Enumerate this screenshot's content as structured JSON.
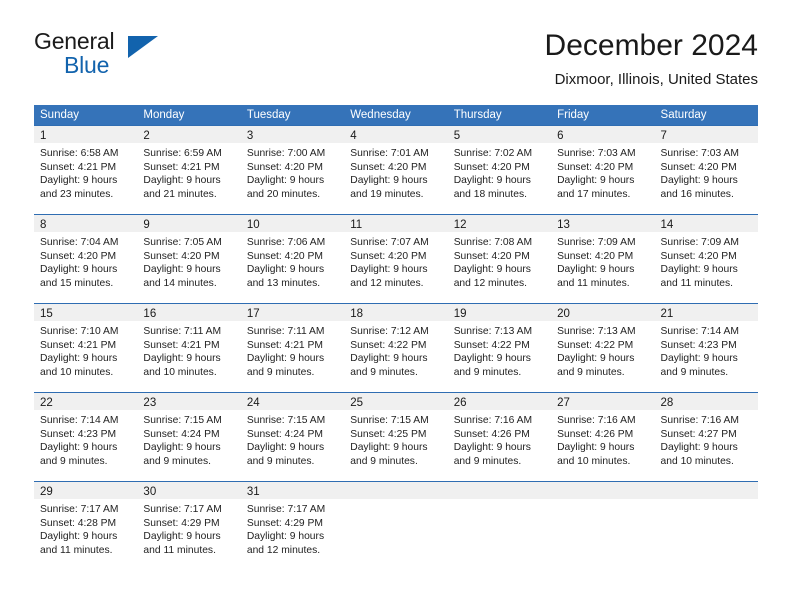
{
  "brand": {
    "name_line1": "General",
    "name_line2": "Blue",
    "triangle_color": "#1263ad",
    "triangle_icon": "triangle-logo-icon"
  },
  "header": {
    "title": "December 2024",
    "subtitle": "Dixmoor, Illinois, United States"
  },
  "colors": {
    "header_row_bg": "#3573b9",
    "row_top_border": "#2f6db2",
    "day_band_bg": "#f0f0f0",
    "brand_blue": "#1263ad",
    "text": "#1a1a1a"
  },
  "weekday_headers": [
    "Sunday",
    "Monday",
    "Tuesday",
    "Wednesday",
    "Thursday",
    "Friday",
    "Saturday"
  ],
  "weeks": [
    [
      {
        "day": "1",
        "sunrise": "Sunrise: 6:58 AM",
        "sunset": "Sunset: 4:21 PM",
        "daylight_1": "Daylight: 9 hours",
        "daylight_2": "and 23 minutes."
      },
      {
        "day": "2",
        "sunrise": "Sunrise: 6:59 AM",
        "sunset": "Sunset: 4:21 PM",
        "daylight_1": "Daylight: 9 hours",
        "daylight_2": "and 21 minutes."
      },
      {
        "day": "3",
        "sunrise": "Sunrise: 7:00 AM",
        "sunset": "Sunset: 4:20 PM",
        "daylight_1": "Daylight: 9 hours",
        "daylight_2": "and 20 minutes."
      },
      {
        "day": "4",
        "sunrise": "Sunrise: 7:01 AM",
        "sunset": "Sunset: 4:20 PM",
        "daylight_1": "Daylight: 9 hours",
        "daylight_2": "and 19 minutes."
      },
      {
        "day": "5",
        "sunrise": "Sunrise: 7:02 AM",
        "sunset": "Sunset: 4:20 PM",
        "daylight_1": "Daylight: 9 hours",
        "daylight_2": "and 18 minutes."
      },
      {
        "day": "6",
        "sunrise": "Sunrise: 7:03 AM",
        "sunset": "Sunset: 4:20 PM",
        "daylight_1": "Daylight: 9 hours",
        "daylight_2": "and 17 minutes."
      },
      {
        "day": "7",
        "sunrise": "Sunrise: 7:03 AM",
        "sunset": "Sunset: 4:20 PM",
        "daylight_1": "Daylight: 9 hours",
        "daylight_2": "and 16 minutes."
      }
    ],
    [
      {
        "day": "8",
        "sunrise": "Sunrise: 7:04 AM",
        "sunset": "Sunset: 4:20 PM",
        "daylight_1": "Daylight: 9 hours",
        "daylight_2": "and 15 minutes."
      },
      {
        "day": "9",
        "sunrise": "Sunrise: 7:05 AM",
        "sunset": "Sunset: 4:20 PM",
        "daylight_1": "Daylight: 9 hours",
        "daylight_2": "and 14 minutes."
      },
      {
        "day": "10",
        "sunrise": "Sunrise: 7:06 AM",
        "sunset": "Sunset: 4:20 PM",
        "daylight_1": "Daylight: 9 hours",
        "daylight_2": "and 13 minutes."
      },
      {
        "day": "11",
        "sunrise": "Sunrise: 7:07 AM",
        "sunset": "Sunset: 4:20 PM",
        "daylight_1": "Daylight: 9 hours",
        "daylight_2": "and 12 minutes."
      },
      {
        "day": "12",
        "sunrise": "Sunrise: 7:08 AM",
        "sunset": "Sunset: 4:20 PM",
        "daylight_1": "Daylight: 9 hours",
        "daylight_2": "and 12 minutes."
      },
      {
        "day": "13",
        "sunrise": "Sunrise: 7:09 AM",
        "sunset": "Sunset: 4:20 PM",
        "daylight_1": "Daylight: 9 hours",
        "daylight_2": "and 11 minutes."
      },
      {
        "day": "14",
        "sunrise": "Sunrise: 7:09 AM",
        "sunset": "Sunset: 4:20 PM",
        "daylight_1": "Daylight: 9 hours",
        "daylight_2": "and 11 minutes."
      }
    ],
    [
      {
        "day": "15",
        "sunrise": "Sunrise: 7:10 AM",
        "sunset": "Sunset: 4:21 PM",
        "daylight_1": "Daylight: 9 hours",
        "daylight_2": "and 10 minutes."
      },
      {
        "day": "16",
        "sunrise": "Sunrise: 7:11 AM",
        "sunset": "Sunset: 4:21 PM",
        "daylight_1": "Daylight: 9 hours",
        "daylight_2": "and 10 minutes."
      },
      {
        "day": "17",
        "sunrise": "Sunrise: 7:11 AM",
        "sunset": "Sunset: 4:21 PM",
        "daylight_1": "Daylight: 9 hours",
        "daylight_2": "and 9 minutes."
      },
      {
        "day": "18",
        "sunrise": "Sunrise: 7:12 AM",
        "sunset": "Sunset: 4:22 PM",
        "daylight_1": "Daylight: 9 hours",
        "daylight_2": "and 9 minutes."
      },
      {
        "day": "19",
        "sunrise": "Sunrise: 7:13 AM",
        "sunset": "Sunset: 4:22 PM",
        "daylight_1": "Daylight: 9 hours",
        "daylight_2": "and 9 minutes."
      },
      {
        "day": "20",
        "sunrise": "Sunrise: 7:13 AM",
        "sunset": "Sunset: 4:22 PM",
        "daylight_1": "Daylight: 9 hours",
        "daylight_2": "and 9 minutes."
      },
      {
        "day": "21",
        "sunrise": "Sunrise: 7:14 AM",
        "sunset": "Sunset: 4:23 PM",
        "daylight_1": "Daylight: 9 hours",
        "daylight_2": "and 9 minutes."
      }
    ],
    [
      {
        "day": "22",
        "sunrise": "Sunrise: 7:14 AM",
        "sunset": "Sunset: 4:23 PM",
        "daylight_1": "Daylight: 9 hours",
        "daylight_2": "and 9 minutes."
      },
      {
        "day": "23",
        "sunrise": "Sunrise: 7:15 AM",
        "sunset": "Sunset: 4:24 PM",
        "daylight_1": "Daylight: 9 hours",
        "daylight_2": "and 9 minutes."
      },
      {
        "day": "24",
        "sunrise": "Sunrise: 7:15 AM",
        "sunset": "Sunset: 4:24 PM",
        "daylight_1": "Daylight: 9 hours",
        "daylight_2": "and 9 minutes."
      },
      {
        "day": "25",
        "sunrise": "Sunrise: 7:15 AM",
        "sunset": "Sunset: 4:25 PM",
        "daylight_1": "Daylight: 9 hours",
        "daylight_2": "and 9 minutes."
      },
      {
        "day": "26",
        "sunrise": "Sunrise: 7:16 AM",
        "sunset": "Sunset: 4:26 PM",
        "daylight_1": "Daylight: 9 hours",
        "daylight_2": "and 9 minutes."
      },
      {
        "day": "27",
        "sunrise": "Sunrise: 7:16 AM",
        "sunset": "Sunset: 4:26 PM",
        "daylight_1": "Daylight: 9 hours",
        "daylight_2": "and 10 minutes."
      },
      {
        "day": "28",
        "sunrise": "Sunrise: 7:16 AM",
        "sunset": "Sunset: 4:27 PM",
        "daylight_1": "Daylight: 9 hours",
        "daylight_2": "and 10 minutes."
      }
    ],
    [
      {
        "day": "29",
        "sunrise": "Sunrise: 7:17 AM",
        "sunset": "Sunset: 4:28 PM",
        "daylight_1": "Daylight: 9 hours",
        "daylight_2": "and 11 minutes."
      },
      {
        "day": "30",
        "sunrise": "Sunrise: 7:17 AM",
        "sunset": "Sunset: 4:29 PM",
        "daylight_1": "Daylight: 9 hours",
        "daylight_2": "and 11 minutes."
      },
      {
        "day": "31",
        "sunrise": "Sunrise: 7:17 AM",
        "sunset": "Sunset: 4:29 PM",
        "daylight_1": "Daylight: 9 hours",
        "daylight_2": "and 12 minutes."
      },
      {
        "day": "",
        "sunrise": "",
        "sunset": "",
        "daylight_1": "",
        "daylight_2": ""
      },
      {
        "day": "",
        "sunrise": "",
        "sunset": "",
        "daylight_1": "",
        "daylight_2": ""
      },
      {
        "day": "",
        "sunrise": "",
        "sunset": "",
        "daylight_1": "",
        "daylight_2": ""
      },
      {
        "day": "",
        "sunrise": "",
        "sunset": "",
        "daylight_1": "",
        "daylight_2": ""
      }
    ]
  ]
}
